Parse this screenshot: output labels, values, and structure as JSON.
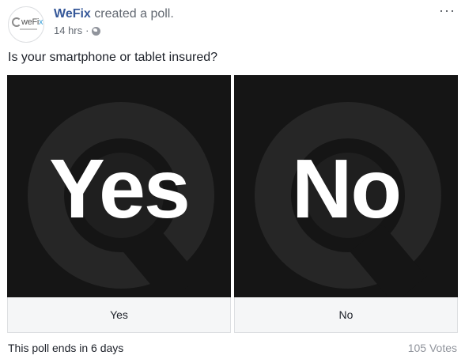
{
  "post": {
    "author": "WeFix",
    "action": "created a poll.",
    "timestamp": "14 hrs",
    "separator": "·",
    "privacy_icon": "globe-icon",
    "more_icon_glyph": "···",
    "avatar": {
      "logo_prefix": "weFi",
      "logo_accent": "x"
    }
  },
  "poll": {
    "question": "Is your smartphone or tablet insured?",
    "options": [
      {
        "image_text": "Yes",
        "label": "Yes"
      },
      {
        "image_text": "No",
        "label": "No"
      }
    ],
    "ends_text": "This poll ends in 6 days",
    "votes_text": "105 Votes"
  },
  "colors": {
    "author_link": "#365899",
    "secondary_text": "#616770",
    "option_image_bg": "#151515",
    "option_label_bg": "#f5f6f7"
  }
}
